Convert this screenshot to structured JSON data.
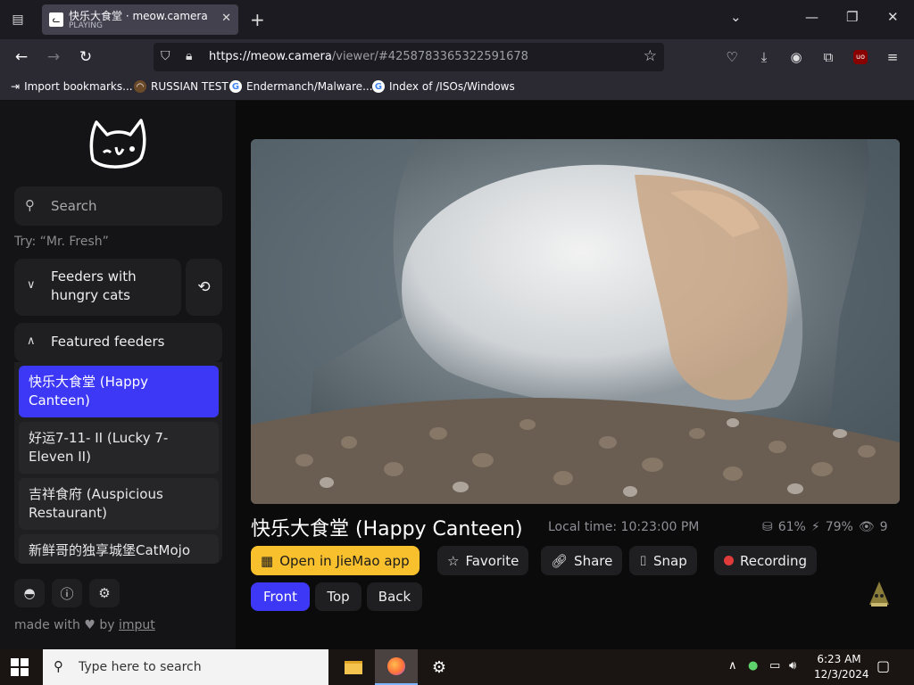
{
  "browser": {
    "tab": {
      "title": "快乐大食堂 · meow.camera",
      "status": "PLAYING"
    },
    "url": {
      "host": "https://meow.camera",
      "path": "/viewer/#4258783365322591678"
    },
    "bookmarks": [
      "Import bookmarks...",
      "RUSSIAN TEST",
      "Endermanch/Malware...",
      "Index of /ISOs/Windows"
    ]
  },
  "sidebar": {
    "search_placeholder": "Search",
    "try_hint": "Try: “Mr. Fresh”",
    "dropdown_label": "Feeders with hungry cats",
    "featured_label": "Featured feeders",
    "feeders": [
      {
        "label": "快乐大食堂 (Happy Canteen)",
        "active": true
      },
      {
        "label": "好运7-11- II  (Lucky 7-Eleven II)",
        "active": false
      },
      {
        "label": "吉祥食府 (Auspicious Restaurant)",
        "active": false
      },
      {
        "label": "新鲜哥的独享城堡CatMojo",
        "active": false
      }
    ],
    "footer": {
      "made_with": "made with",
      "by": "by",
      "author": "imput"
    }
  },
  "viewer": {
    "title": "快乐大食堂 (Happy Canteen)",
    "local_time": "Local time: 10:23:00 PM",
    "stats": {
      "food": "61%",
      "battery": "79%",
      "viewers": "9"
    },
    "actions": {
      "open_app": "Open in JieMao app",
      "favorite": "Favorite",
      "share": "Share",
      "snap": "Snap",
      "recording": "Recording"
    },
    "views": [
      "Front",
      "Top",
      "Back"
    ],
    "active_view": "Front"
  },
  "taskbar": {
    "search_placeholder": "Type here to search",
    "time": "6:23 AM",
    "date": "12/3/2024"
  }
}
